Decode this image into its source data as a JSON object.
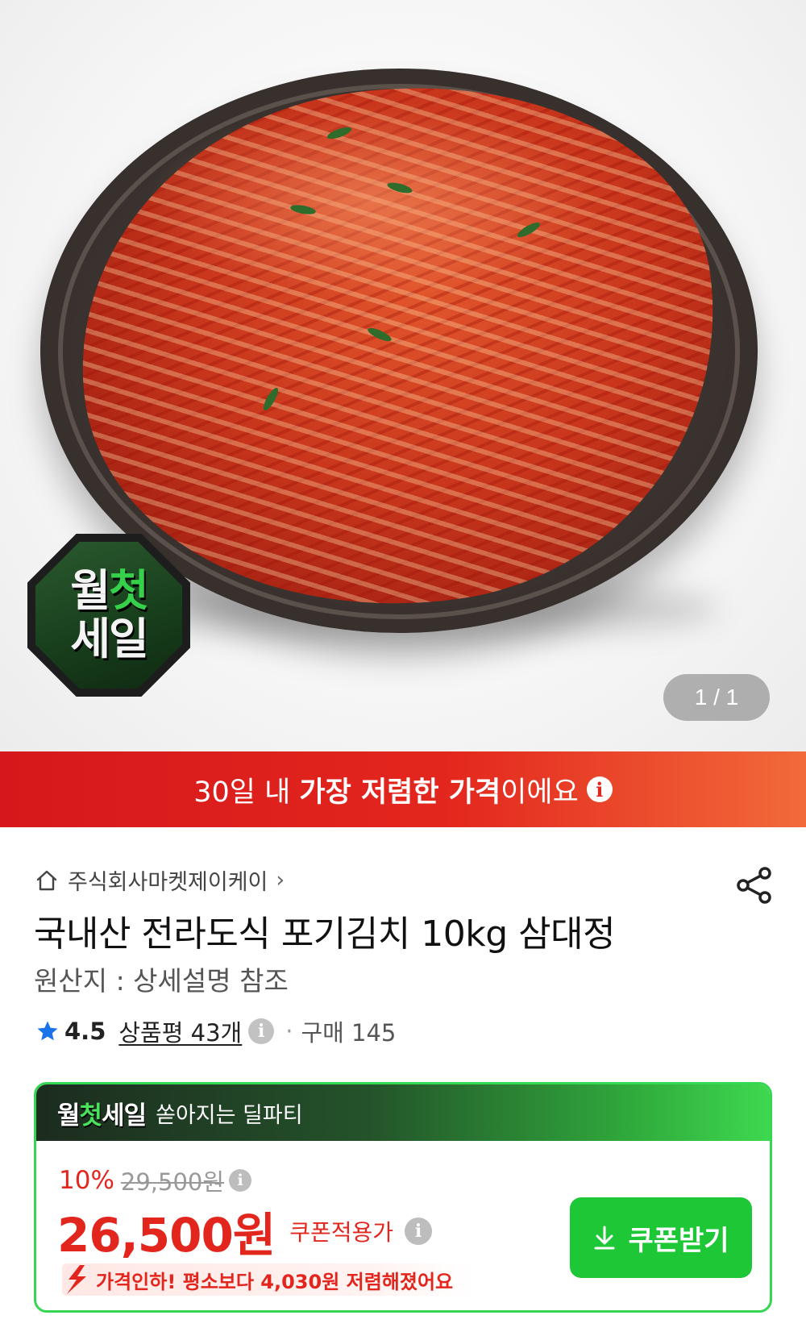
{
  "hero": {
    "badge_line1_a": "월",
    "badge_line1_b": "첫",
    "badge_line2": "세일",
    "pager": "1 / 1"
  },
  "banner": {
    "prefix": "30일 내 ",
    "highlight": "가장 저렴한 가격",
    "suffix": "이에요",
    "info_icon": "i"
  },
  "product": {
    "seller": "주식회사마켓제이케이",
    "seller_chevron": "›",
    "title": "국내산 전라도식 포기김치 10kg 삼대정",
    "origin": "원산지 : 상세설명 참조",
    "rating": "4.5",
    "reviews": "상품평 43개",
    "dot": "·",
    "purchases": "구매 145"
  },
  "sale": {
    "logo_a": "월",
    "logo_b": "첫",
    "logo_c": "세일",
    "subtitle": "쏟아지는 딜파티",
    "discount_pct": "10%",
    "original_price": "29,500원",
    "price": "26,500원",
    "price_label": "쿠폰적용가",
    "drop_text": "가격인하! 평소보다 4,030원 저렴해졌어요",
    "coupon_button": "쿠폰받기"
  },
  "colors": {
    "accent_red": "#e3261d",
    "accent_green": "#1ec735",
    "sale_border": "#35d651"
  },
  "icons": [
    "home-icon",
    "share-icon",
    "star-icon",
    "info-icon",
    "download-icon",
    "price-drop-arrow-icon"
  ]
}
